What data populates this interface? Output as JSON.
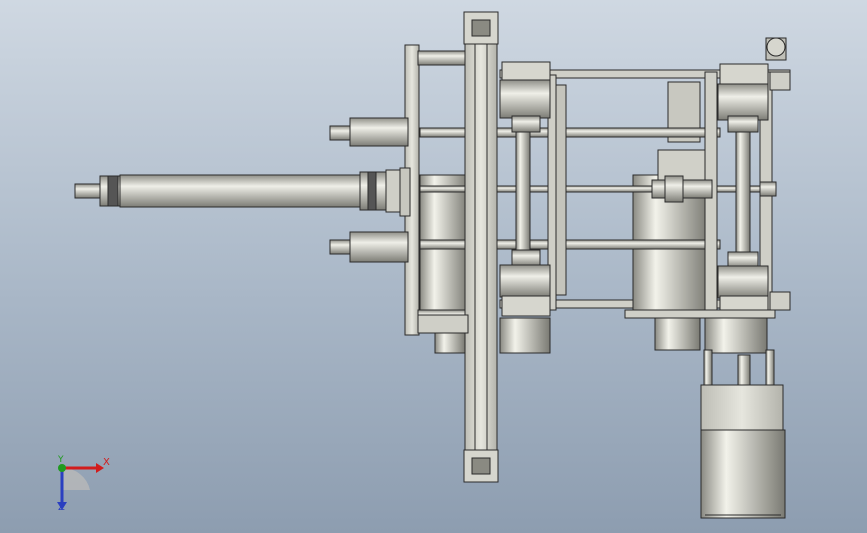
{
  "viewport": {
    "background_top": "#cfd8e2",
    "background_bottom": "#8d9db0"
  },
  "model": {
    "part_color": "#d8d8d0",
    "shade_color": "#a8a8a0",
    "edge_color": "#2a2a2a"
  },
  "triad": {
    "x_label": "X",
    "y_label": "Y",
    "z_label": "Z",
    "x_color": "#d21c1c",
    "y_color": "#1f9a1f",
    "z_color": "#2a3fc0"
  }
}
